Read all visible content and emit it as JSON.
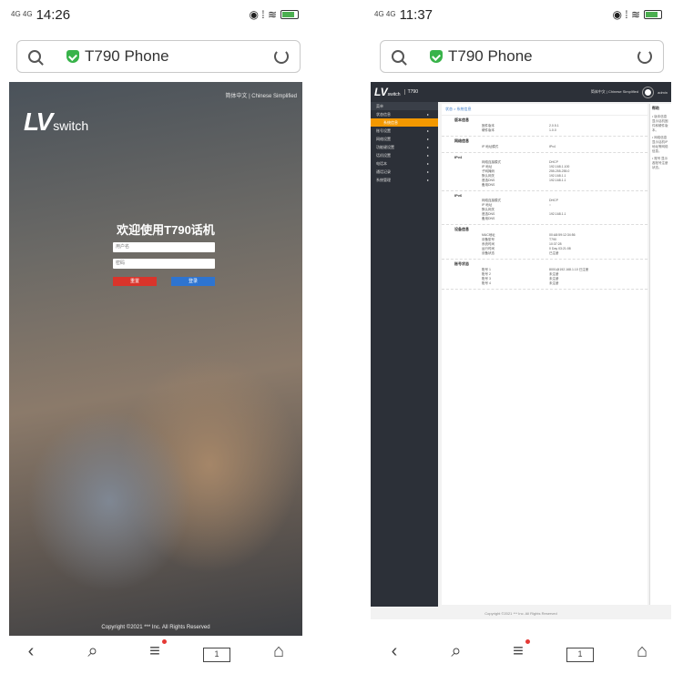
{
  "left": {
    "status": {
      "signal": "4G 4G",
      "time": "14:26",
      "icons": "◉ ⁞ ≋"
    },
    "address": {
      "title": "T790 Phone"
    },
    "login": {
      "lang_switch": "简体中文 | Chinese Simplified",
      "logo_lv": "LV",
      "logo_switch": "switch",
      "welcome": "欢迎使用T790话机",
      "username_placeholder": "用户名",
      "password_placeholder": "密码",
      "reset_button": "重置",
      "login_button": "登录",
      "copyright": "Copyright ©2021 *** Inc. All Rights Reserved"
    },
    "nav": {
      "back": "‹",
      "search": "⌕",
      "menu": "≡",
      "tabs": "1",
      "home": "⌂"
    }
  },
  "right": {
    "status": {
      "signal": "4G 4G",
      "time": "11:37",
      "icons": "◉ ⁞ ≋"
    },
    "address": {
      "title": "T790 Phone"
    },
    "admin": {
      "logo_lv": "LV",
      "logo_switch": "switch",
      "model": "T790",
      "top_right": "简体中文 | Chinese Simplified",
      "user": "admin",
      "side_header": "菜单",
      "side_items": [
        {
          "label": "状态信息",
          "arrow": "▸"
        },
        {
          "label": "系统信息",
          "arrow": ""
        },
        {
          "label": "账号设置",
          "arrow": "▸"
        },
        {
          "label": "网络设置",
          "arrow": "▸"
        },
        {
          "label": "功能键设置",
          "arrow": "▸"
        },
        {
          "label": "话机设置",
          "arrow": "▸"
        },
        {
          "label": "电话本",
          "arrow": "▸"
        },
        {
          "label": "通话记录",
          "arrow": "▸"
        },
        {
          "label": "系统管理",
          "arrow": "▸"
        }
      ],
      "breadcrumb": "状态 > 系统信息",
      "sections": [
        {
          "title": "版本信息",
          "rows": [
            {
              "k": "固件版本",
              "v": "2.0.5.1"
            },
            {
              "k": "硬件版本",
              "v": "1.0.0"
            }
          ]
        },
        {
          "title": "网络信息",
          "rows": [
            {
              "k": "IP 地址模式",
              "v": "IPv4"
            }
          ]
        },
        {
          "title": "IPv4",
          "rows": [
            {
              "k": "网络连接模式",
              "v": "DHCP"
            },
            {
              "k": "IP 地址",
              "v": "192.168.1.100"
            },
            {
              "k": "子网掩码",
              "v": "255.255.255.0"
            },
            {
              "k": "默认网关",
              "v": "192.168.1.1"
            },
            {
              "k": "首选DNS",
              "v": "192.168.1.1"
            },
            {
              "k": "备用DNS",
              "v": ""
            }
          ]
        },
        {
          "title": "IPv6",
          "rows": [
            {
              "k": "网络连接模式",
              "v": "DHCP"
            },
            {
              "k": "IP 地址",
              "v": "::"
            },
            {
              "k": "默认网关",
              "v": ""
            },
            {
              "k": "首选DNS",
              "v": "192.168.1.1"
            },
            {
              "k": "备用DNS",
              "v": ""
            }
          ]
        },
        {
          "title": "设备信息",
          "rows": [
            {
              "k": "MAC地址",
              "v": "00:A8:59:12:34:56"
            },
            {
              "k": "设备型号",
              "v": "T790"
            },
            {
              "k": "系统时间",
              "v": "10:37:28"
            },
            {
              "k": "运行时间",
              "v": "0 Day 03:21:08"
            },
            {
              "k": "设备状态",
              "v": "已注册"
            }
          ]
        },
        {
          "title": "账号状态",
          "rows": [
            {
              "k": "账号 1",
              "v": "8001@192.168.1.10 已注册"
            },
            {
              "k": "账号 2",
              "v": "未注册"
            },
            {
              "k": "账号 3",
              "v": "未注册"
            },
            {
              "k": "账号 4",
              "v": "未注册"
            }
          ]
        }
      ],
      "right_panel": {
        "title": "帮助",
        "text1": "• 版本信息 显示话机固件和硬件版本。",
        "text2": "• 网络信息 显示话机IP地址等网络信息。",
        "text3": "• 账号 显示各账号注册状态。"
      },
      "copyright": "Copyright ©2021 *** Inc. All Rights Reserved"
    },
    "nav": {
      "back": "‹",
      "search": "⌕",
      "menu": "≡",
      "tabs": "1",
      "home": "⌂"
    }
  }
}
